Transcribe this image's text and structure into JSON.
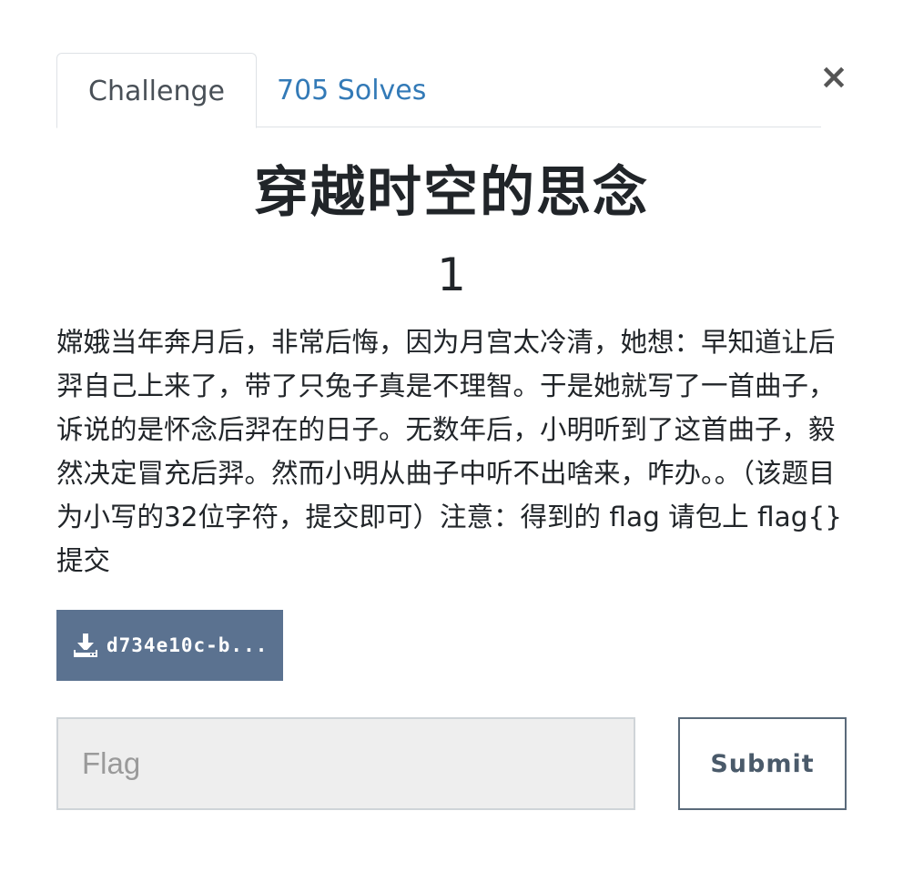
{
  "tabs": {
    "challenge_label": "Challenge",
    "solves_label": "705 Solves"
  },
  "close": {
    "symbol": "×"
  },
  "challenge": {
    "name": "穿越时空的思念",
    "value": "1",
    "description": "嫦娥当年奔月后，非常后悔，因为月宫太冷清，她想：早知道让后羿自己上来了，带了只兔子真是不理智。于是她就写了一首曲子，诉说的是怀念后羿在的日子。无数年后，小明听到了这首曲子，毅然决定冒充后羿。然而小明从曲子中听不出啥来，咋办。。（该题目为小写的32位字符，提交即可）注意：得到的 flag 请包上 flag{} 提交"
  },
  "file": {
    "label": "d734e10c-b...",
    "icon": "download-icon"
  },
  "form": {
    "flag_placeholder": "Flag",
    "submit_label": "Submit"
  },
  "colors": {
    "download_button_bg": "#5b7290",
    "link": "#337ab7",
    "input_bg": "#eeeeee"
  }
}
